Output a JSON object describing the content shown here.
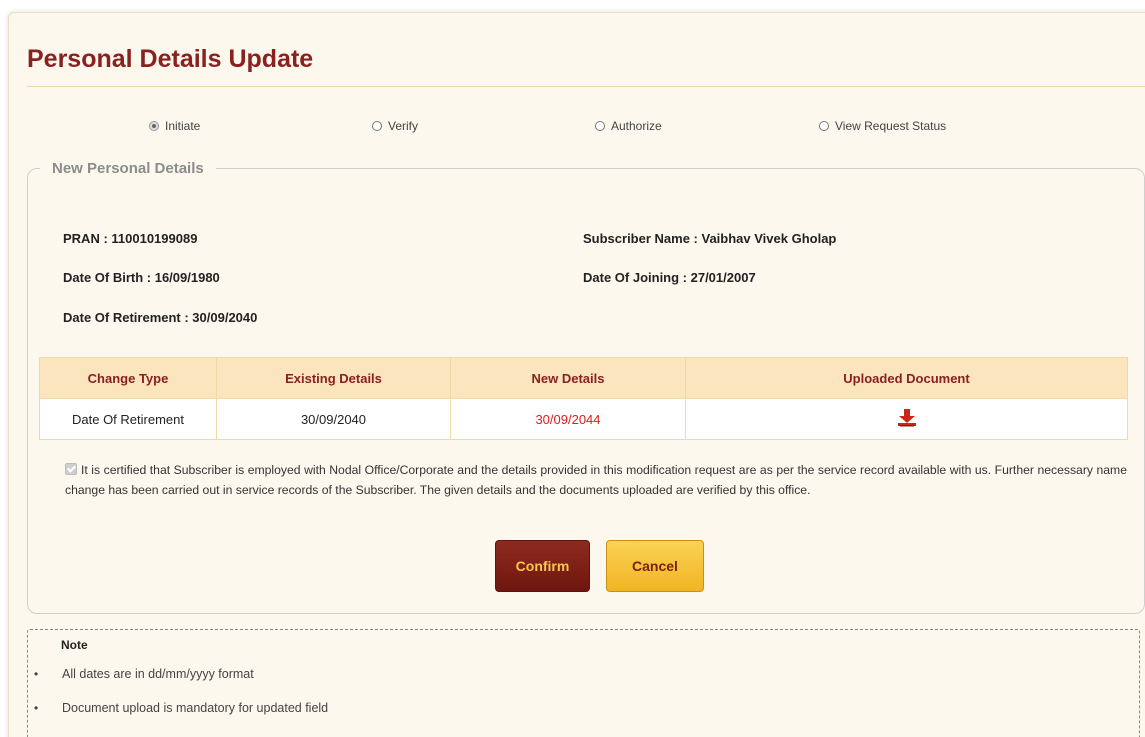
{
  "page": {
    "title": "Personal Details Update"
  },
  "steps": [
    {
      "label": "Initiate",
      "selected": true
    },
    {
      "label": "Verify",
      "selected": false
    },
    {
      "label": "Authorize",
      "selected": false
    },
    {
      "label": "View Request Status",
      "selected": false
    }
  ],
  "section": {
    "legend": "New Personal Details"
  },
  "subscriber": {
    "pran": "PRAN : 110010199089",
    "name": "Subscriber Name : Vaibhav Vivek Gholap",
    "dob": "Date Of Birth : 16/09/1980",
    "doj": "Date Of Joining : 27/01/2007",
    "dor": "Date Of Retirement : 30/09/2040"
  },
  "table": {
    "headers": [
      "Change Type",
      "Existing Details",
      "New Details",
      "Uploaded Document"
    ],
    "rows": [
      {
        "change_type": "Date Of Retirement",
        "existing": "30/09/2040",
        "new": "30/09/2044",
        "document_icon": "download-icon"
      }
    ]
  },
  "certification": {
    "checked": true,
    "text": "It is certified that Subscriber is employed with Nodal Office/Corporate and the details provided in this modification request are as per the service record available with us. Further necessary name change has been carried out in service records of the Subscriber. The given details and the documents uploaded are verified by this office."
  },
  "buttons": {
    "confirm": "Confirm",
    "cancel": "Cancel"
  },
  "note": {
    "title": "Note",
    "items": [
      "All dates are in dd/mm/yyyy format",
      "Document upload is mandatory for updated field"
    ]
  },
  "colors": {
    "title": "#8a2020",
    "new_value": "#e01b1b",
    "confirm_bg": "#7d1f16",
    "cancel_bg": "#f5c23a"
  }
}
